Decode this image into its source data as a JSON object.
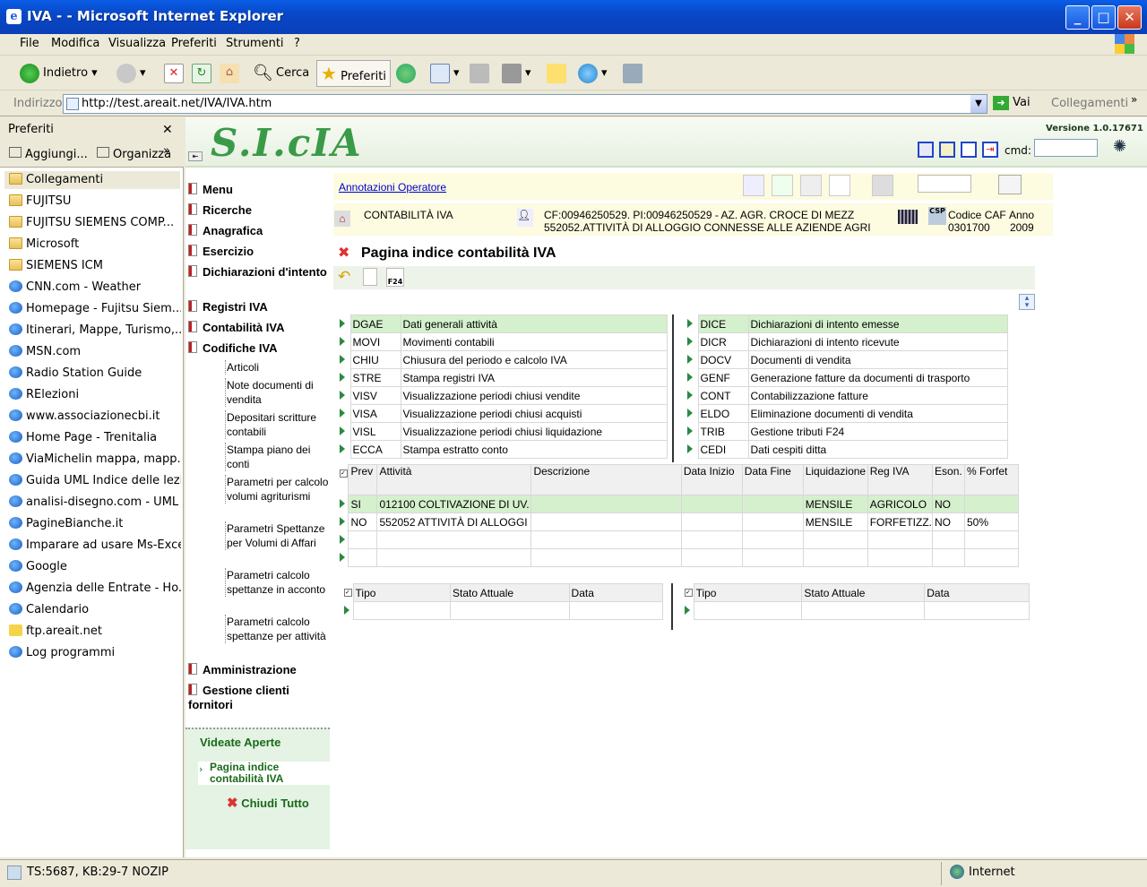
{
  "window": {
    "title": "IVA - - Microsoft Internet Explorer"
  },
  "menu": [
    "File",
    "Modifica",
    "Visualizza",
    "Preferiti",
    "Strumenti",
    "?"
  ],
  "toolbar": {
    "back": "Indietro",
    "search": "Cerca",
    "favorites": "Preferiti"
  },
  "address": {
    "label": "Indirizzo",
    "url": "http://test.areait.net/IVA/IVA.htm",
    "go": "Vai",
    "links": "Collegamenti"
  },
  "favorites": {
    "title": "Preferiti",
    "add": "Aggiungi...",
    "organize": "Organizza",
    "items": [
      {
        "label": "Collegamenti",
        "type": "folder"
      },
      {
        "label": "FUJITSU",
        "type": "folder"
      },
      {
        "label": "FUJITSU SIEMENS COMP...",
        "type": "folder"
      },
      {
        "label": "Microsoft",
        "type": "folder"
      },
      {
        "label": "SIEMENS ICM",
        "type": "folder"
      },
      {
        "label": "CNN.com - Weather",
        "type": "page"
      },
      {
        "label": "Homepage - Fujitsu Siem...",
        "type": "page"
      },
      {
        "label": "Itinerari, Mappe, Turismo,...",
        "type": "page"
      },
      {
        "label": "MSN.com",
        "type": "page"
      },
      {
        "label": "Radio Station Guide",
        "type": "page"
      },
      {
        "label": "RElezioni",
        "type": "page"
      },
      {
        "label": "www.associazionecbi.it",
        "type": "page"
      },
      {
        "label": "Home Page - Trenitalia",
        "type": "page"
      },
      {
        "label": "ViaMichelin  mappa, mapp...",
        "type": "page"
      },
      {
        "label": "Guida UML Indice delle lezi...",
        "type": "page"
      },
      {
        "label": "analisi-disegno.com - UML",
        "type": "page"
      },
      {
        "label": "PagineBianche.it",
        "type": "page"
      },
      {
        "label": "Imparare ad usare Ms-Excel",
        "type": "page"
      },
      {
        "label": "Google",
        "type": "page"
      },
      {
        "label": "Agenzia delle Entrate - Ho...",
        "type": "page"
      },
      {
        "label": "Calendario",
        "type": "page"
      },
      {
        "label": "ftp.areait.net",
        "type": "ftp"
      },
      {
        "label": "Log programmi",
        "type": "page"
      }
    ]
  },
  "app": {
    "logo": "S.I.cIA",
    "version": "Versione 1.0.17671",
    "cmd_label": "cmd:",
    "annotazioni": "Annotazioni Operatore",
    "context": {
      "module": "CONTABILITÀ IVA",
      "cf": "CF:00946250529. PI:00946250529 - AZ. AGR. CROCE DI MEZZ",
      "activity": "552052.ATTIVITÀ DI ALLOGGIO CONNESSE ALLE AZIENDE AGRI",
      "caf_label": "Codice CAF",
      "caf_value": "0301700",
      "anno_label": "Anno",
      "anno_value": "2009",
      "csp": "CSP"
    },
    "page_title": "Pagina indice contabilità IVA",
    "f24": "F24"
  },
  "nav": {
    "items": [
      "Menu",
      "Ricerche",
      "Anagrafica",
      "Esercizio",
      "Dichiarazioni d'intento",
      "Registri IVA",
      "Contabilità IVA",
      "Codifiche IVA"
    ],
    "subitems": [
      "Articoli",
      "Note documenti di vendita",
      "Depositari scritture contabili",
      "Stampa piano dei conti",
      "Parametri per calcolo volumi agriturismi",
      "Parametri Spettanze per Volumi di Affari",
      "Parametri calcolo spettanze in acconto",
      "Parametri calcolo spettanze per attività"
    ],
    "items2": [
      "Amministrazione",
      "Gestione clienti fornitori"
    ],
    "open_title": "Videate Aperte",
    "open_item": "Pagina indice contabilità IVA",
    "close_all": "Chiudi Tutto"
  },
  "functions_left": [
    [
      "DGAE",
      "Dati generali attività"
    ],
    [
      "MOVI",
      "Movimenti contabili"
    ],
    [
      "CHIU",
      "Chiusura del periodo e calcolo IVA"
    ],
    [
      "STRE",
      "Stampa registri IVA"
    ],
    [
      "VISV",
      "Visualizzazione periodi chiusi vendite"
    ],
    [
      "VISA",
      "Visualizzazione periodi chiusi acquisti"
    ],
    [
      "VISL",
      "Visualizzazione periodi chiusi liquidazione"
    ],
    [
      "ECCA",
      "Stampa estratto conto"
    ]
  ],
  "functions_right": [
    [
      "DICE",
      "Dichiarazioni di intento emesse"
    ],
    [
      "DICR",
      "Dichiarazioni di intento ricevute"
    ],
    [
      "DOCV",
      "Documenti di vendita"
    ],
    [
      "GENF",
      "Generazione fatture da documenti di trasporto"
    ],
    [
      "CONT",
      "Contabilizzazione fatture"
    ],
    [
      "ELDO",
      "Eliminazione documenti di vendita"
    ],
    [
      "TRIB",
      "Gestione tributi F24"
    ],
    [
      "CEDI",
      "Dati cespiti ditta"
    ]
  ],
  "activity_table": {
    "headers": [
      "Prev",
      "Attività",
      "Descrizione",
      "Data Inizio",
      "Data Fine",
      "Liquidazione",
      "Reg IVA",
      "Eson.",
      "% Forfet"
    ],
    "rows": [
      [
        "SI",
        "012100 COLTIVAZIONE DI UV.",
        "",
        "",
        "",
        "MENSILE",
        "AGRICOLO",
        "NO",
        ""
      ],
      [
        "NO",
        "552052 ATTIVITÀ DI ALLOGGI",
        "",
        "",
        "",
        "MENSILE",
        "FORFETIZZ.",
        "NO",
        "50%"
      ]
    ]
  },
  "state_tables": {
    "headers": [
      "Tipo",
      "Stato Attuale",
      "Data"
    ]
  },
  "status": {
    "left": "TS:5687, KB:29-7 NOZIP",
    "zone": "Internet"
  }
}
